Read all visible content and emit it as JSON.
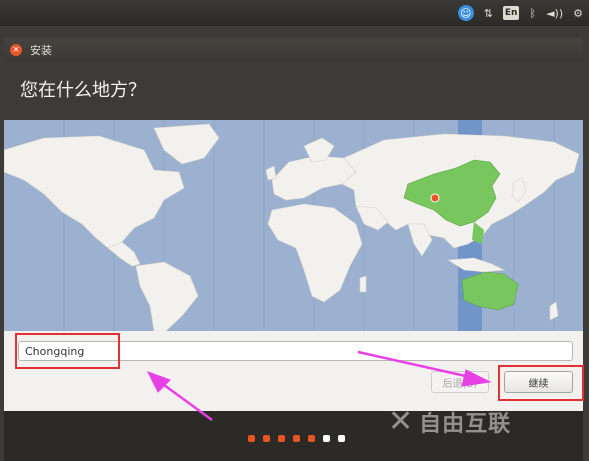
{
  "top_panel": {
    "items": [
      {
        "name": "accessibility-icon",
        "glyph": "☺"
      },
      {
        "name": "network-arrows-icon",
        "glyph": "⇅"
      },
      {
        "name": "keyboard-layout-indicator",
        "glyph": "En"
      },
      {
        "name": "bluetooth-icon",
        "glyph": "ᛒ"
      },
      {
        "name": "volume-icon",
        "glyph": "◄))"
      },
      {
        "name": "system-gear-icon",
        "glyph": "⚙"
      }
    ]
  },
  "window": {
    "title": "安装",
    "close_glyph": "×",
    "question": "您在什么地方？"
  },
  "location": {
    "value": "Chongqing",
    "placeholder": ""
  },
  "buttons": {
    "back": "后退(B)",
    "continue": "继续"
  },
  "progress": {
    "total_steps": 7,
    "completed_steps": 5,
    "completed_color": "#e95420",
    "pending_color": "#ffffff"
  },
  "watermark": {
    "text": "自由互联"
  },
  "colors": {
    "ocean": "#9bb1cf",
    "land": "#f3f1ee",
    "selected_region": "#77c75e",
    "timezone_band": "#6a8fc8",
    "highlight_box": "#e03232",
    "annotation_arrow": "#e640e6"
  }
}
